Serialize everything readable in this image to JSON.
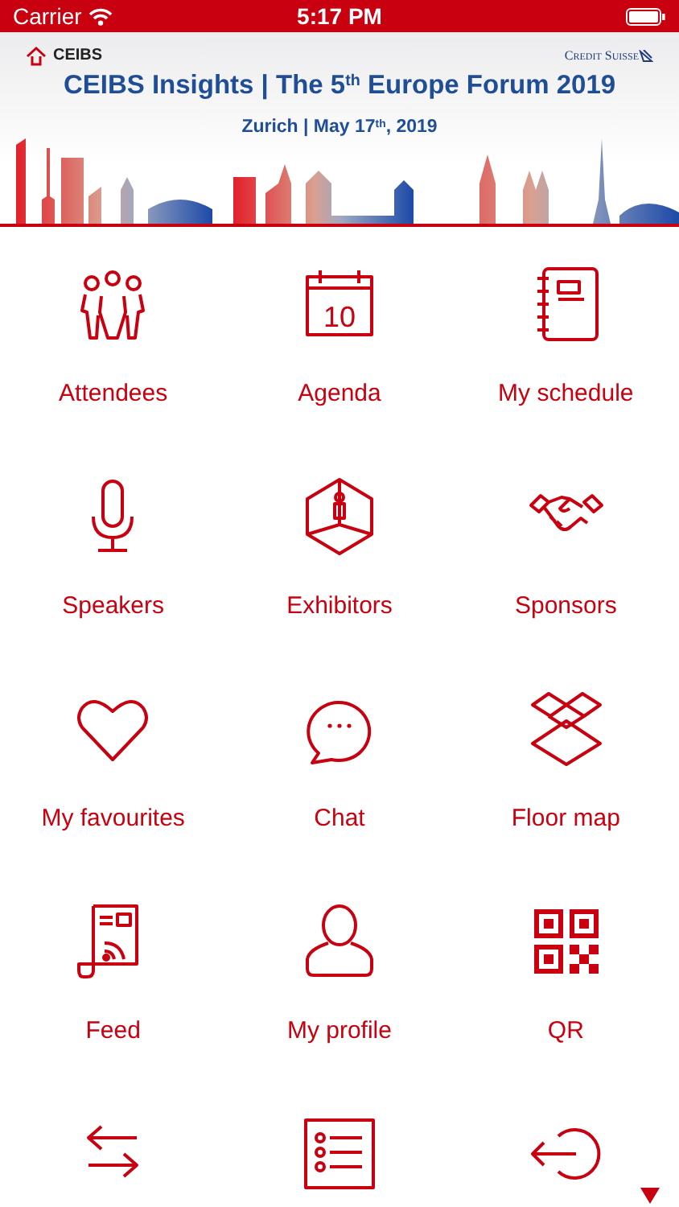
{
  "status_bar": {
    "carrier": "Carrier",
    "time": "5:17 PM"
  },
  "banner": {
    "left_logo": "CEIBS",
    "right_logo": "Credit Suisse",
    "title": "CEIBS Insights | The 5$^{th}$ Europe Forum 2019",
    "subtitle": "Zurich | May 17$^{th}$, 2019"
  },
  "calendar_icon_day": "10",
  "menu": [
    {
      "kind": "tile",
      "label": "Attendees"
    },
    {
      "kind": "tile",
      "label": "Agenda"
    },
    {
      "kind": "tile",
      "label": "My schedule"
    },
    {
      "kind": "tile",
      "label": "Speakers"
    },
    {
      "kind": "tile",
      "label": "Exhibitors"
    },
    {
      "kind": "tile",
      "label": "Sponsors"
    },
    {
      "kind": "tile",
      "label": "My favourites"
    },
    {
      "kind": "tile",
      "label": "Chat"
    },
    {
      "kind": "tile",
      "label": "Floor map"
    },
    {
      "kind": "tile",
      "label": "Feed"
    },
    {
      "kind": "tile",
      "label": "My profile"
    },
    {
      "kind": "tile",
      "label": "QR"
    },
    {
      "kind": "icon_only"
    },
    {
      "kind": "icon_only"
    },
    {
      "kind": "icon_only"
    }
  ]
}
